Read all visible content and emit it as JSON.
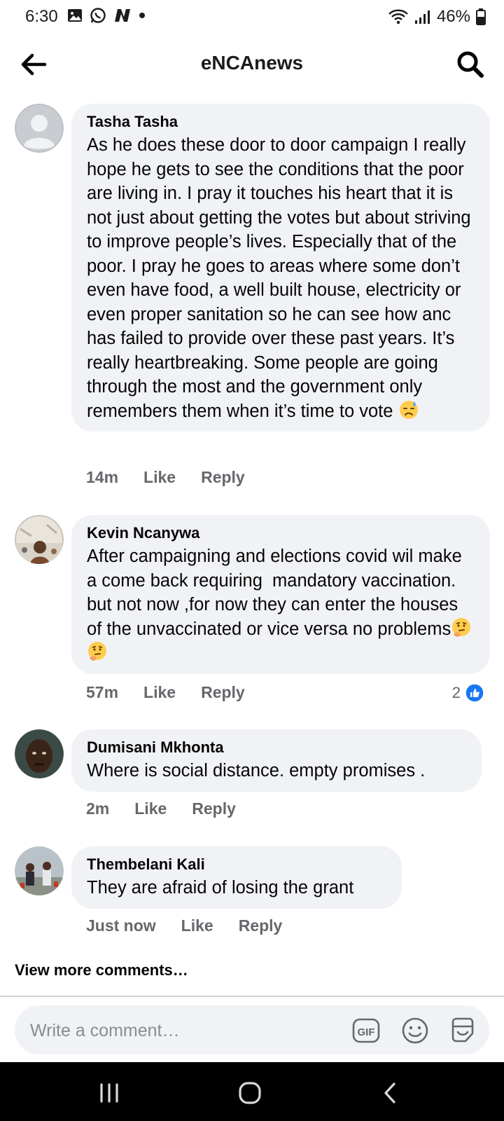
{
  "status_bar": {
    "time": "6:30",
    "battery": "46%",
    "icons": [
      "gallery-icon",
      "whatsapp-icon",
      "n-app-icon",
      "dot-icon",
      "wifi-icon",
      "signal-icon",
      "battery-icon"
    ]
  },
  "header": {
    "title": "eNCAnews",
    "back_icon": "back-arrow-icon",
    "search_icon": "search-icon"
  },
  "comments": [
    {
      "author": "Tasha Tasha",
      "text": "As he does these door to door campaign I really hope he gets to see the conditions that the poor are living in. I pray it touches his heart that it is not just about getting the votes but about striving to improve people’s lives. Especially that of the poor. I pray he goes to areas where some don’t even have food, a well built house, electricity or even proper sanitation so he can see how anc has failed to provide over these past years. It’s really heartbreaking. Some people are going through the most and the government only remembers them when it’s time to vote",
      "emoji": "downcast-sweat-emoji",
      "time": "14m",
      "like": "Like",
      "reply": "Reply"
    },
    {
      "author": "Kevin Ncanywa",
      "text": "After campaigning and elections covid wil make a come back requiring  mandatory vaccination. but not now ,for now they can enter the houses of the unvaccinated or vice versa no problems",
      "emoji": "thinking-face-emoji",
      "time": "57m",
      "like": "Like",
      "reply": "Reply",
      "reaction_count": "2"
    },
    {
      "author": "Dumisani Mkhonta",
      "text": "Where is social distance. empty promises .",
      "time": "2m",
      "like": "Like",
      "reply": "Reply"
    },
    {
      "author": "Thembelani Kali",
      "text": "They are afraid of losing the grant",
      "time": "Just now",
      "like": "Like",
      "reply": "Reply"
    }
  ],
  "view_more": "View more comments…",
  "composer": {
    "placeholder": "Write a comment…",
    "icons": [
      "gif-icon",
      "emoji-icon",
      "sticker-icon"
    ]
  },
  "colors": {
    "bubble": "#f0f2f5",
    "meta_text": "#65676b",
    "like_blue": "#1877f2"
  }
}
